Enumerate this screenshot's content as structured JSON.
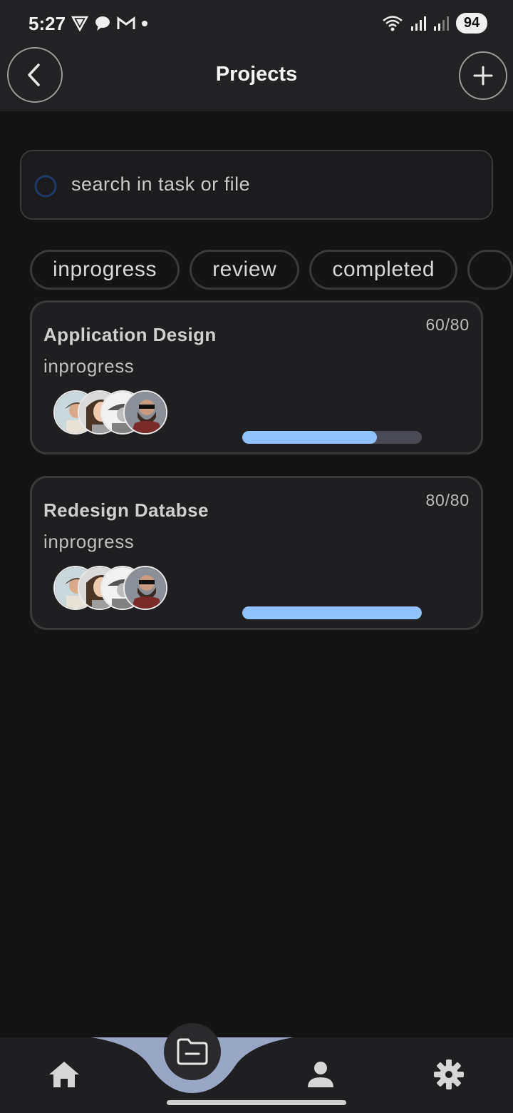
{
  "status_bar": {
    "time": "5:27",
    "battery": "94",
    "left_icons": [
      "vpn-icon",
      "chat-icon",
      "gmail-icon",
      "dot-icon"
    ],
    "right_icons": [
      "wifi-icon",
      "signal-icon",
      "signal-icon"
    ]
  },
  "header": {
    "title": "Projects",
    "back_icon": "chevron-left-icon",
    "add_icon": "plus-icon"
  },
  "search": {
    "placeholder": "search in task or file",
    "icon": "search-icon"
  },
  "filters": {
    "chips": [
      "inprogress",
      "review",
      "completed",
      ""
    ]
  },
  "projects": [
    {
      "title": "Application Design",
      "status": "inprogress",
      "count": "60/80",
      "progress": 0.75
    },
    {
      "title": "Redesign Databse",
      "status": "inprogress",
      "count": "80/80",
      "progress": 1.0
    }
  ],
  "bottom_nav": {
    "items": [
      "home-icon",
      "folder-icon",
      "person-icon",
      "settings-icon"
    ],
    "active": "folder-icon"
  },
  "colors": {
    "accent": "#90c2ff",
    "background": "#141414",
    "surface": "#222224",
    "card": "#1f1f21",
    "nav_wave": "#9aa7c4"
  }
}
